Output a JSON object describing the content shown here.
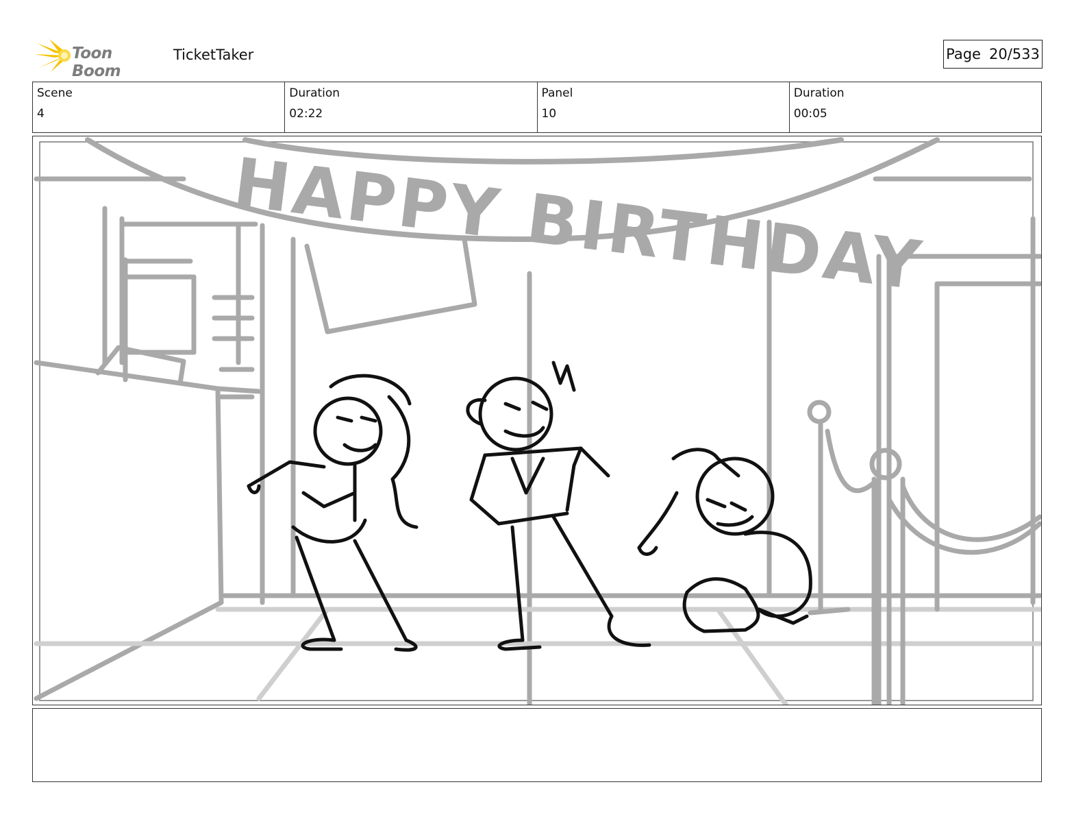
{
  "header": {
    "brand": "Toon Boom",
    "project": "TicketTaker",
    "page_label": "Page",
    "page_value": "20/533"
  },
  "info": {
    "scene_label": "Scene",
    "scene_value": "4",
    "scene_duration_label": "Duration",
    "scene_duration_value": "02:22",
    "panel_label": "Panel",
    "panel_value": "10",
    "panel_duration_label": "Duration",
    "panel_duration_value": "00:05"
  },
  "panel": {
    "banner_text": "HAPPY BIRTHDAY"
  },
  "notes": {
    "text": ""
  },
  "colors": {
    "logo_yellow": "#f5c400",
    "logo_gray": "#7d7d7d",
    "sketch_gray": "#a9a9a9",
    "ink": "#111111"
  }
}
